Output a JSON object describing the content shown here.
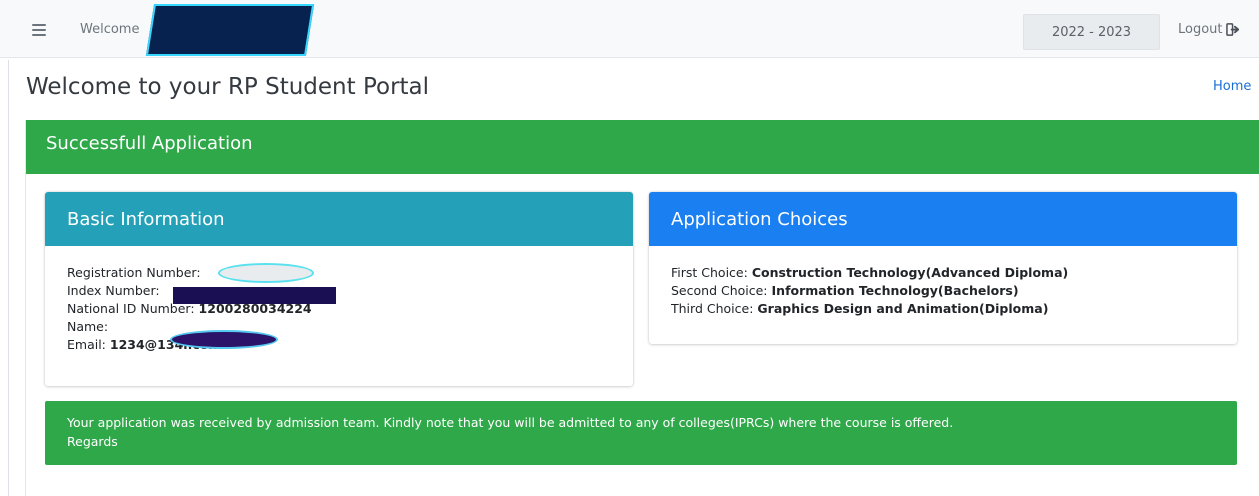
{
  "navbar": {
    "welcome_label": "Welcome",
    "academic_year": "2022 - 2023",
    "logout_label": "Logout"
  },
  "page": {
    "title": "Welcome to your RP Student Portal",
    "home_link": "Home"
  },
  "success_card": {
    "title": "Successfull Application"
  },
  "basic_info": {
    "title": "Basic Information",
    "registration_label": "Registration Number:",
    "index_label": "Index Number:",
    "national_id_label": "National ID Number:",
    "national_id_value": "1200280034224",
    "name_label": "Name:",
    "email_label": "Email:",
    "email_value": "1234@134r.com"
  },
  "application_choices": {
    "title": "Application Choices",
    "first_label": "First Choice:",
    "first_value": "Construction Technology(Advanced Diploma)",
    "second_label": "Second Choice:",
    "second_value": "Information Technology(Bachelors)",
    "third_label": "Third Choice:",
    "third_value": "Graphics Design and Animation(Diploma)"
  },
  "notice": {
    "message": "Your application was received by admission team. Kindly note that you will be admitted to any of colleges(IPRCs) where the course is offered.",
    "signoff": "Regards"
  },
  "colors": {
    "success_green": "#2fa84a",
    "info_teal": "#24a1b8",
    "primary_blue": "#1a7ff0"
  }
}
